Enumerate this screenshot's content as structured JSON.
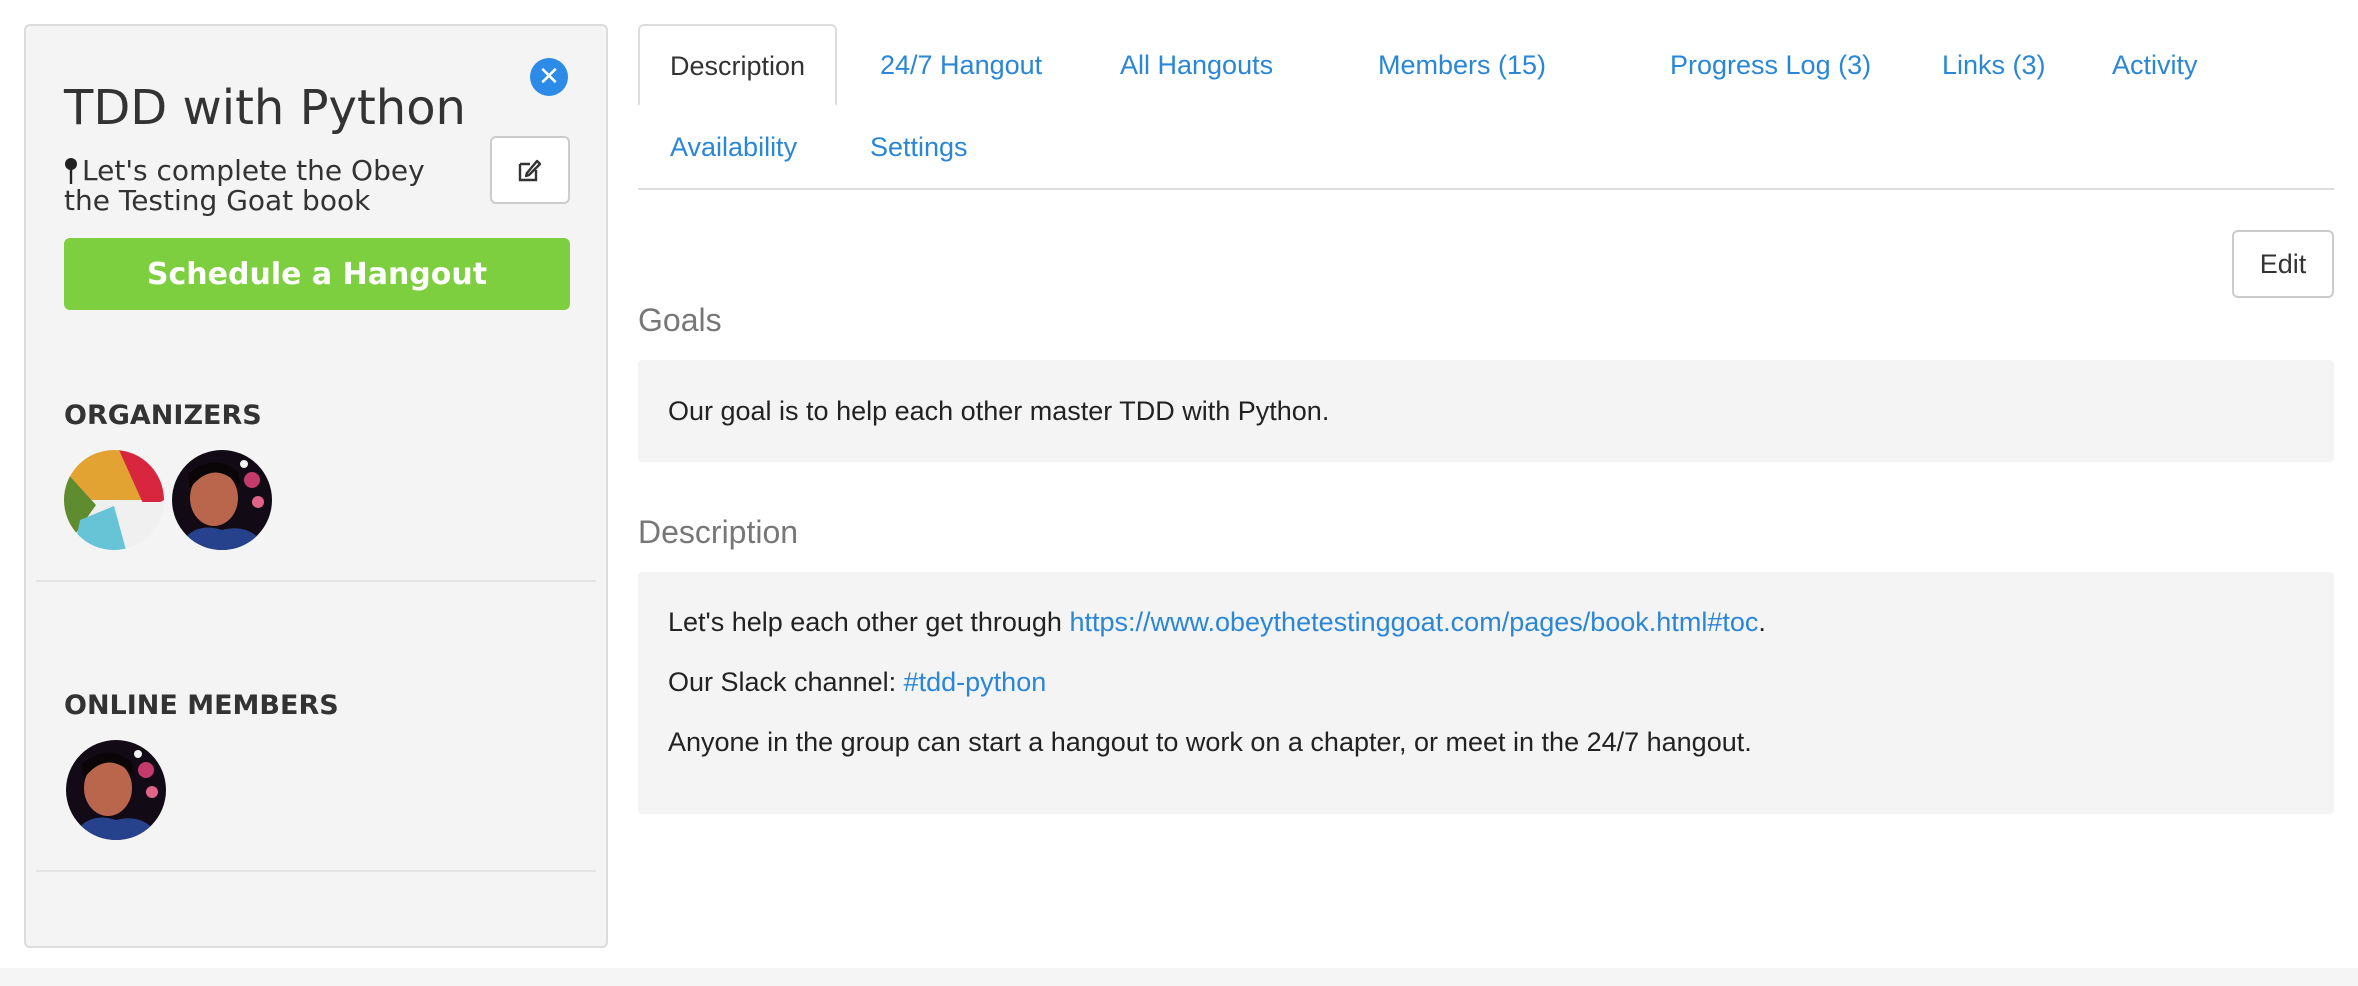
{
  "sidebar": {
    "title": "TDD with Python",
    "tagline": "Let's complete the Obey the Testing Goat book",
    "schedule_button": "Schedule a Hangout",
    "organizers_heading": "ORGANIZERS",
    "online_members_heading": "ONLINE MEMBERS",
    "icons": {
      "close": "close-circle-icon",
      "pin": "map-pin-icon",
      "edit": "pencil-square-icon"
    }
  },
  "tabs": [
    {
      "label": "Description",
      "active": true
    },
    {
      "label": "24/7 Hangout"
    },
    {
      "label": "All Hangouts"
    },
    {
      "label": "Members (15)"
    },
    {
      "label": "Progress Log (3)"
    },
    {
      "label": "Links (3)"
    },
    {
      "label": "Activity"
    },
    {
      "label": "Availability"
    },
    {
      "label": "Settings"
    }
  ],
  "main": {
    "edit_button": "Edit",
    "goals": {
      "heading": "Goals",
      "text": "Our goal is to help each other master TDD with Python."
    },
    "description": {
      "heading": "Description",
      "line1_prefix": "Let's help each other get through ",
      "line1_link": "https://www.obeythetestinggoat.com/pages/book.html#toc",
      "line1_suffix": ".",
      "line2_prefix": "Our Slack channel: ",
      "line2_link": "#tdd-python",
      "line3": "Anyone in the group can start a hangout to work on a chapter, or meet in the 24/7 hangout."
    }
  },
  "colors": {
    "link": "#2a86d6",
    "schedule_button": "#7dcf3f",
    "close_button": "#2b8be6",
    "sidebar_bg": "#f4f4f4",
    "panel_bg": "#f4f4f4"
  }
}
